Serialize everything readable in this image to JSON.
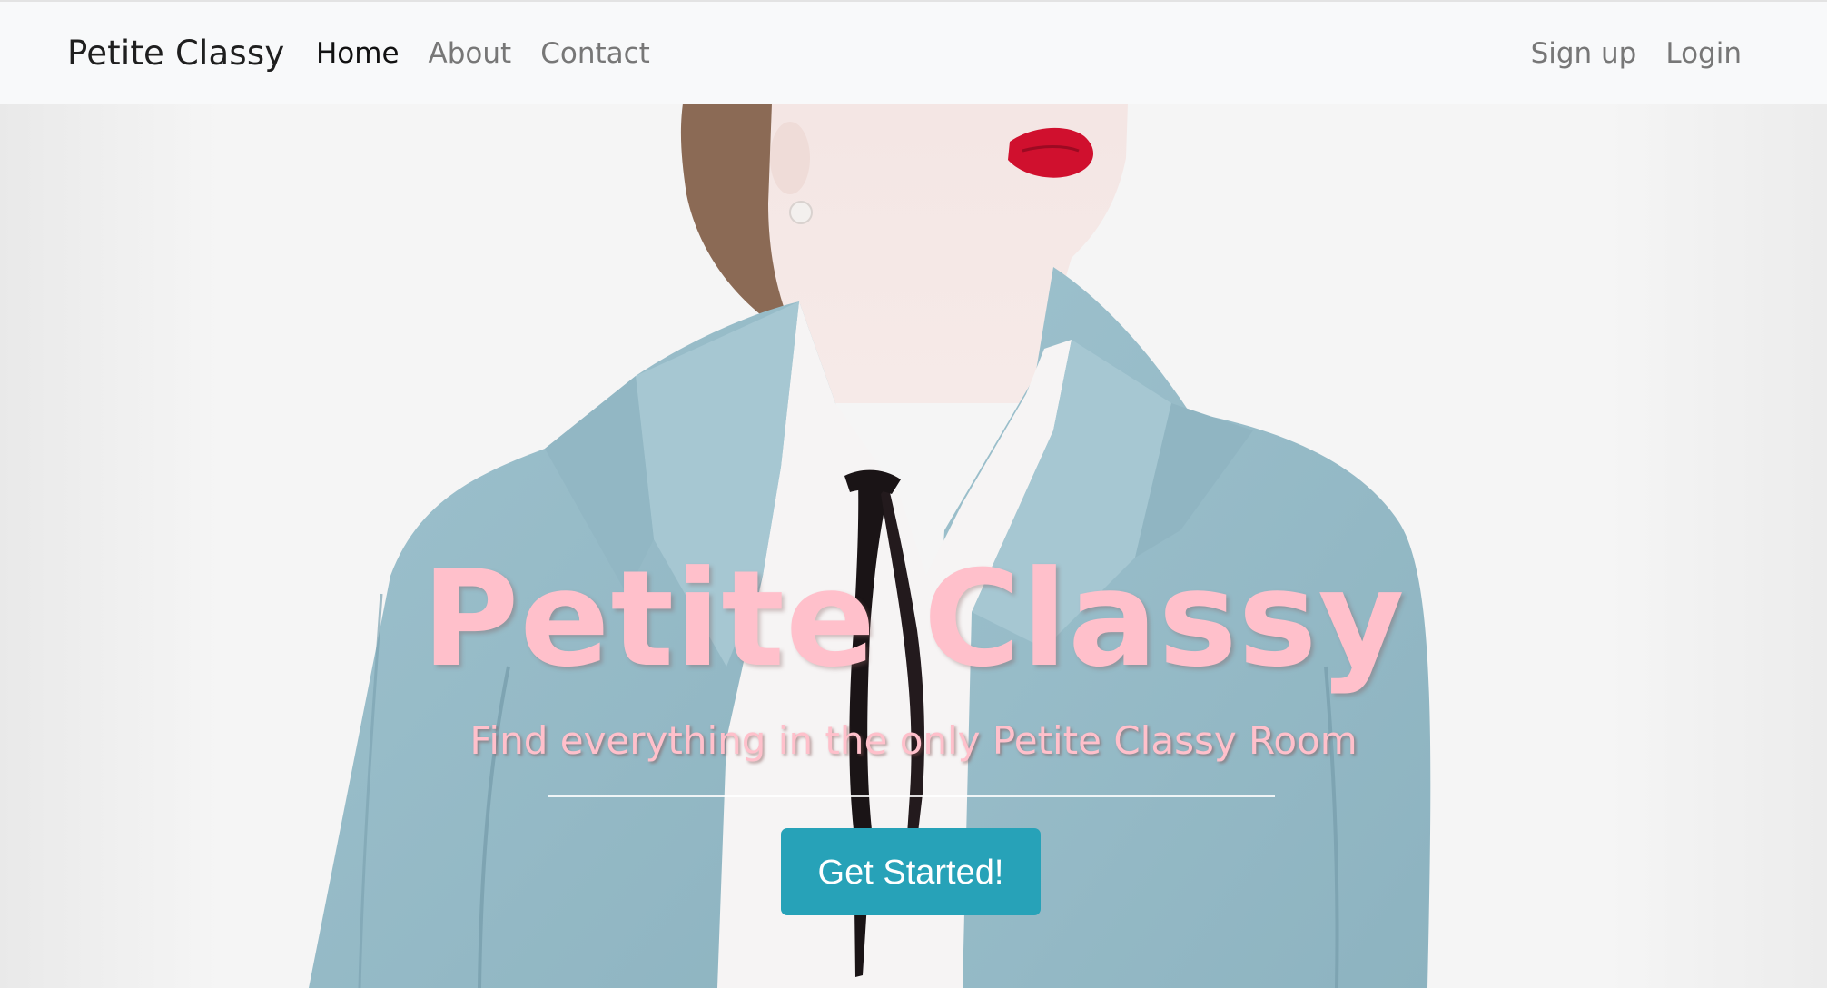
{
  "navbar": {
    "brand": "Petite Classy",
    "left_links": [
      {
        "label": "Home",
        "active": true
      },
      {
        "label": "About",
        "active": false
      },
      {
        "label": "Contact",
        "active": false
      }
    ],
    "right_links": [
      {
        "label": "Sign up"
      },
      {
        "label": "Login"
      }
    ]
  },
  "hero": {
    "background_image": "woman-in-light-blue-blazer-with-black-ribbon-tie",
    "title": "Petite Classy",
    "subtitle": "Find everything in the only Petite Classy Room",
    "cta_label": "Get Started!"
  },
  "colors": {
    "title_pink": "#ffc0cb",
    "cta_teal": "#27a2b8",
    "navbar_bg": "#f8f9fa",
    "blazer_blue": "#94b9c6",
    "lips_red": "#d0102e"
  }
}
